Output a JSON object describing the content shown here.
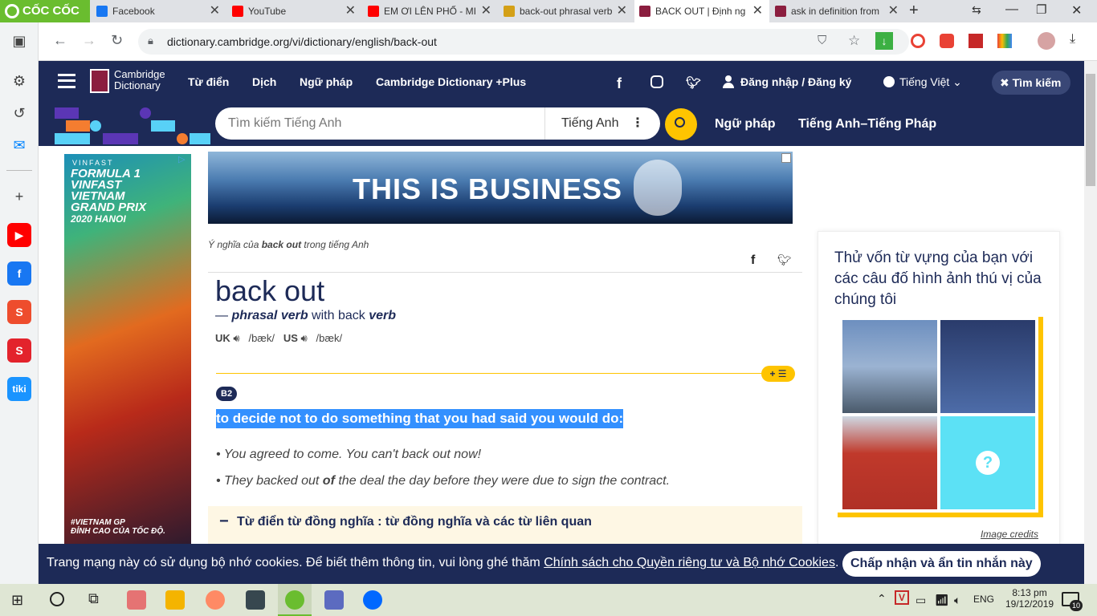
{
  "browser": {
    "brand": "CỐC CỐC",
    "tabs": [
      {
        "title": "Facebook",
        "color": "#1877f2"
      },
      {
        "title": "YouTube",
        "color": "#ff0000"
      },
      {
        "title": "EM ƠI LÊN PHỐ - MI",
        "color": "#ff0000"
      },
      {
        "title": "back-out phrasal verb",
        "color": "#d4a017"
      },
      {
        "title": "BACK OUT | Định ng",
        "color": "#8b1e3f",
        "active": true
      },
      {
        "title": "ask in definition from",
        "color": "#8b1e3f"
      }
    ],
    "new_tab": "+",
    "url": "dictionary.cambridge.org/vi/dictionary/english/back-out"
  },
  "sidebar_apps": [
    {
      "name": "youtube",
      "label": "▶",
      "color": "#ff0000"
    },
    {
      "name": "facebook",
      "label": "f",
      "color": "#1877f2"
    },
    {
      "name": "shopee",
      "label": "S",
      "color": "#ee4d2d"
    },
    {
      "name": "sendo",
      "label": "S",
      "color": "#e3232c"
    },
    {
      "name": "tiki",
      "label": "tiki",
      "color": "#1a94ff"
    }
  ],
  "header": {
    "logo_line1": "Cambridge",
    "logo_line2": "Dictionary",
    "nav": [
      "Từ điển",
      "Dịch",
      "Ngữ pháp",
      "Cambridge Dictionary +Plus"
    ],
    "login": "Đăng nhập / Đăng ký",
    "language": "Tiếng Việt",
    "search_button": "Tìm kiếm"
  },
  "search": {
    "placeholder": "Tìm kiếm Tiếng Anh",
    "lang": "Tiếng Anh",
    "links": [
      "Ngữ pháp",
      "Tiếng Anh–Tiếng Pháp"
    ]
  },
  "ads": {
    "left_lines": [
      "FORMULA 1",
      "VINFAST",
      "VIETNAM",
      "GRAND PRIX",
      "2020 HANOI"
    ],
    "left_brand": "VINFAST",
    "left_footer1": "#VIETNAM GP",
    "left_footer2": "ĐỈNH CAO CỦA TỐC ĐỘ.",
    "banner_text": "THIS IS BUSINESS"
  },
  "entry": {
    "breadcrumb_pre": "Ý nghĩa của ",
    "breadcrumb_word": "back out",
    "breadcrumb_post": " trong tiếng Anh",
    "headword": "back out",
    "pos_dash": "— ",
    "pos_type": "phrasal verb",
    "pos_with": " with back ",
    "pos_verb": "verb",
    "uk": "UK",
    "uk_ipa": "/bæk/",
    "us": "US",
    "us_ipa": "/bæk/",
    "level": "B2",
    "definition": "to decide not to do something that you had said you would do:",
    "example1": "You agreed to come. You can't back out now!",
    "example2_pre": "They backed out ",
    "example2_bold": "of",
    "example2_post": " the deal the day before they were due to sign the contract.",
    "thesaurus": "Từ điển từ đồng nghĩa : từ đồng nghĩa và các từ liên quan"
  },
  "quiz": {
    "title": "Thử vốn từ vựng của bạn với các câu đố hình ảnh thú vị của chúng tôi",
    "credits": "Image credits",
    "question_mark": "?"
  },
  "cookies": {
    "message": "Trang mạng này có sử dụng bộ nhớ cookies. Để biết thêm thông tin, vui lòng ghé thăm ",
    "link": "Chính sách cho Quyền riêng tư và Bộ nhớ Cookies",
    "end": ".",
    "accept": "Chấp nhận và ẩn tin nhắn này"
  },
  "taskbar": {
    "lang": "ENG",
    "time": "8:13 pm",
    "date": "19/12/2019",
    "notif": "10"
  }
}
